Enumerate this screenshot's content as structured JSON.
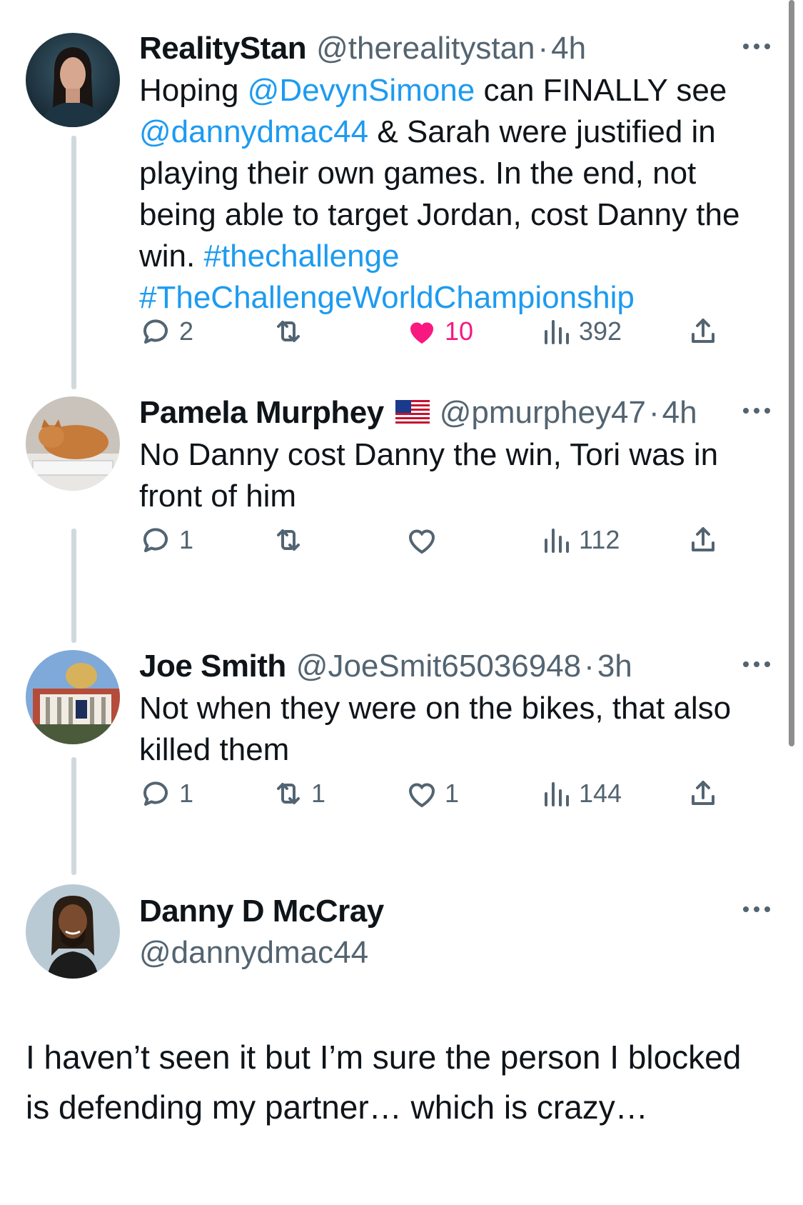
{
  "colors": {
    "link": "#1d9bf0",
    "like_active": "#f91880",
    "muted": "#536471",
    "thread_line": "#cfd9de"
  },
  "tweets": [
    {
      "name": "RealityStan",
      "handle": "@therealitystan",
      "dot": "·",
      "time": "4h",
      "text_parts": [
        {
          "t": "Hoping ",
          "link": false
        },
        {
          "t": "@DevynSimone",
          "link": true
        },
        {
          "t": " can FINALLY see ",
          "link": false
        },
        {
          "t": "@dannydmac44",
          "link": true
        },
        {
          "t": " & Sarah were justified in playing their own games. In the end, not being able to target Jordan, cost Danny the win. ",
          "link": false
        },
        {
          "t": "#thechallenge",
          "link": true
        },
        {
          "t": " ",
          "link": false
        },
        {
          "t": "#TheChallengeWorldChampionship",
          "link": true
        }
      ],
      "replies": "2",
      "retweets": "",
      "likes": "10",
      "views": "392",
      "liked": true
    },
    {
      "name": "Pamela Murphey",
      "flag": "us-flag",
      "handle": "@pmurphey47",
      "dot": "·",
      "time": "4h",
      "text": "No Danny cost Danny the win, Tori was in front of him",
      "replies": "1",
      "retweets": "",
      "likes": "",
      "views": "112",
      "liked": false
    },
    {
      "name": "Joe Smith",
      "handle": "@JoeSmit65036948",
      "dot": "·",
      "time": "3h",
      "text": "Not when they were on the bikes, that also killed them",
      "replies": "1",
      "retweets": "1",
      "likes": "1",
      "views": "144",
      "liked": false
    },
    {
      "name": "Danny D McCray",
      "handle": "@dannydmac44",
      "text": "I haven’t seen it but I’m sure the person I blocked is defending my partner… which is crazy…"
    }
  ],
  "icons": {
    "reply": "reply-icon",
    "retweet": "retweet-icon",
    "like": "heart-icon",
    "views": "views-icon",
    "share": "share-icon",
    "more": "more-icon"
  }
}
